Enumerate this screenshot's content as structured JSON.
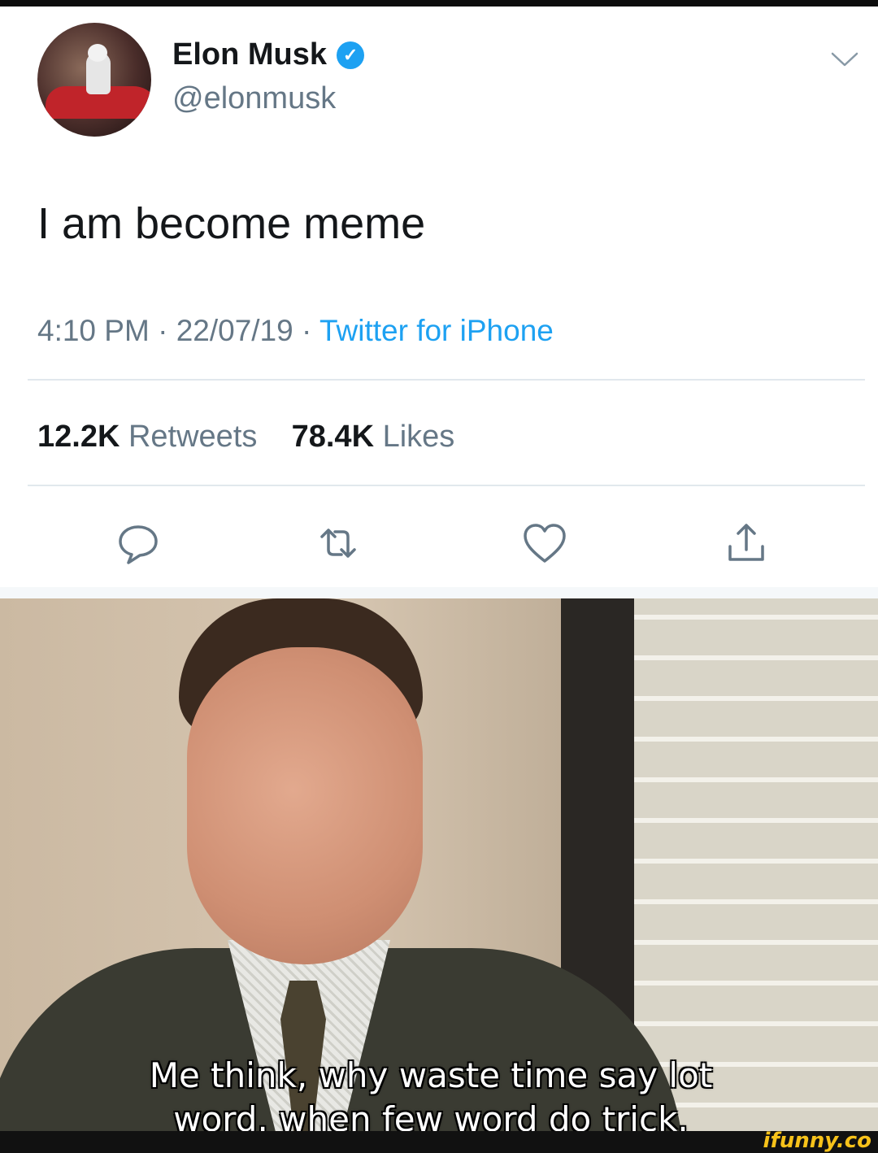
{
  "tweet": {
    "display_name": "Elon Musk",
    "verified_glyph": "✓",
    "handle": "@elonmusk",
    "text": "I am become meme",
    "time": "4:10 PM",
    "date": "22/07/19",
    "separator": "·",
    "source": "Twitter for iPhone",
    "retweets_count": "12.2K",
    "retweets_label": "Retweets",
    "likes_count": "78.4K",
    "likes_label": "Likes",
    "icons": [
      "reply-icon",
      "retweet-icon",
      "like-icon",
      "share-icon",
      "chevron-down-icon"
    ]
  },
  "meme": {
    "caption_line1": "Me think, why waste time say lot",
    "caption_line2": "word. when few word do trick."
  },
  "watermark": "ifunny.co",
  "colors": {
    "twitter_blue": "#1da1f2",
    "text_primary": "#14171a",
    "text_secondary": "#657786",
    "ifunny_yellow": "#f7c21a"
  }
}
